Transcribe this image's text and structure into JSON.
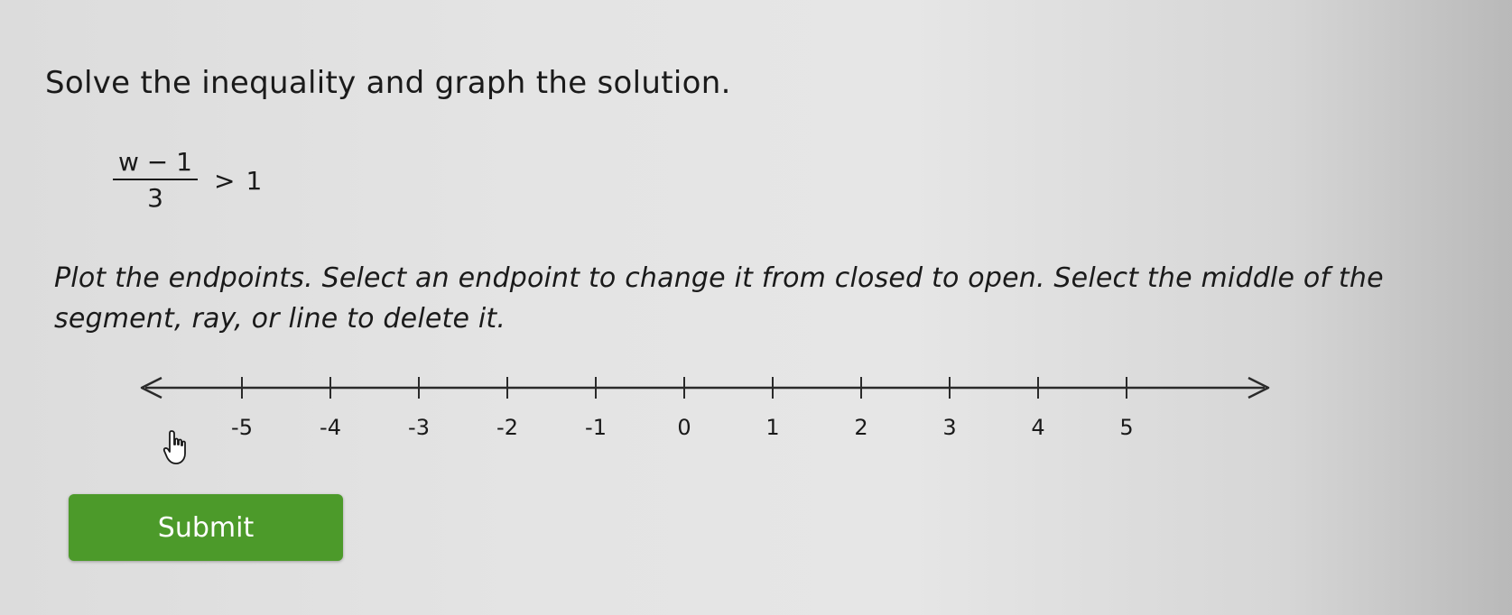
{
  "question": {
    "title": "Solve the inequality and graph the solution.",
    "inequality": {
      "numerator": "w − 1",
      "denominator": "3",
      "relation": ">",
      "right_side": "1"
    },
    "instructions": "Plot the endpoints. Select an endpoint to change it from closed to open. Select the middle of the segment, ray, or line to delete it."
  },
  "number_line": {
    "min": -5,
    "max": 5,
    "ticks": [
      "-5",
      "-4",
      "-3",
      "-2",
      "-1",
      "0",
      "1",
      "2",
      "3",
      "4",
      "5"
    ],
    "has_left_arrow": true,
    "has_right_arrow": true
  },
  "cursor": {
    "icon": "hand-pointer-icon"
  },
  "submit": {
    "label": "Submit",
    "color": "#4c9a2a"
  },
  "colors": {
    "text": "#1a1a1a",
    "line": "#2a2a2a"
  }
}
